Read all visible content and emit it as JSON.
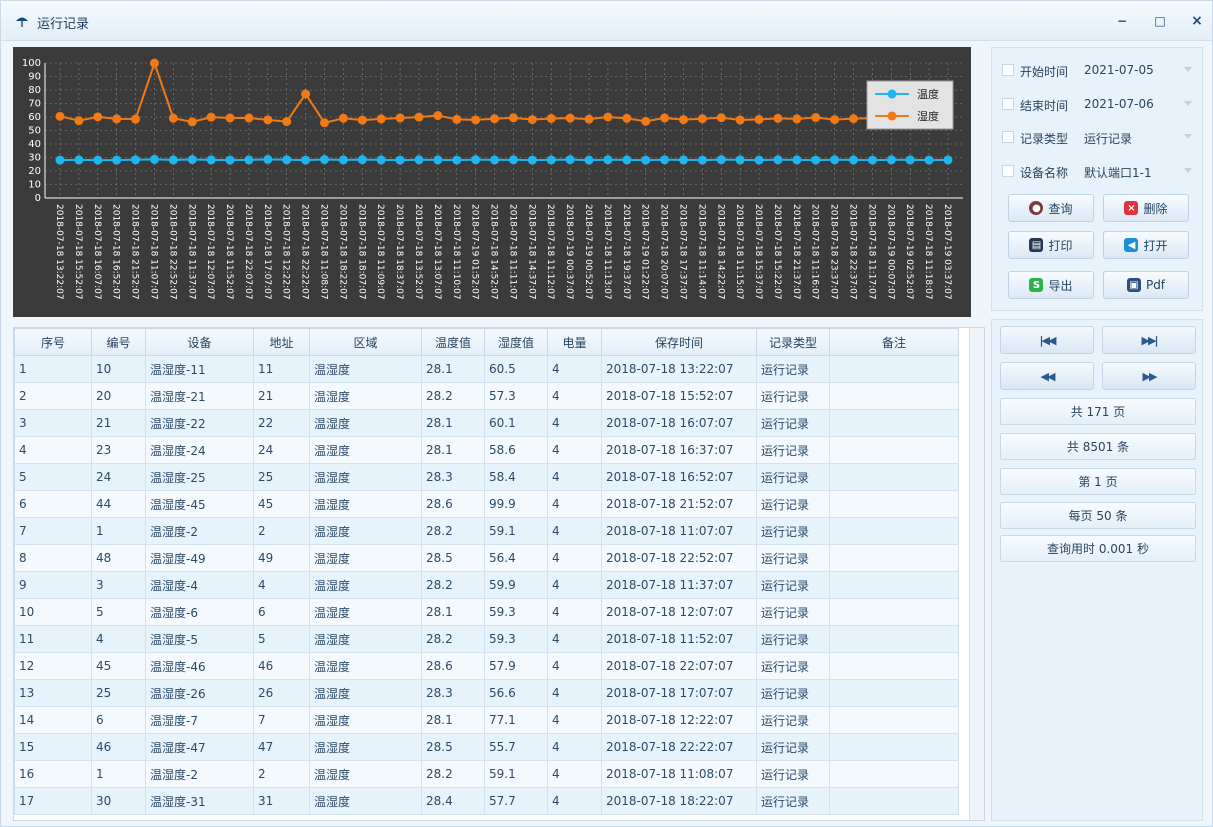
{
  "window": {
    "title": "运行记录",
    "controls": {
      "minimize": "−",
      "maximize": "□",
      "close": "×"
    }
  },
  "chart_data": {
    "type": "line",
    "ylim": [
      0,
      100
    ],
    "yticks": [
      0,
      10,
      20,
      30,
      40,
      50,
      60,
      70,
      80,
      90,
      100
    ],
    "grid": true,
    "legend_position": "top-right",
    "background": "#3b3b3b",
    "categories": [
      "2018-07-18 13:22:07",
      "2018-07-18 15:52:07",
      "2018-07-18 16:07:07",
      "2018-07-18 16:52:07",
      "2018-07-18 21:52:07",
      "2018-07-18 11:07:07",
      "2018-07-18 22:52:07",
      "2018-07-18 11:37:07",
      "2018-07-18 12:07:07",
      "2018-07-18 11:52:07",
      "2018-07-18 22:07:07",
      "2018-07-18 17:07:07",
      "2018-07-18 12:22:07",
      "2018-07-18 22:22:07",
      "2018-07-18 11:08:07",
      "2018-07-18 18:22:07",
      "2018-07-18 18:07:07",
      "2018-07-18 11:09:07",
      "2018-07-18 18:37:07",
      "2018-07-18 13:52:07",
      "2018-07-18 13:07:07",
      "2018-07-18 11:10:07",
      "2018-07-19 01:52:07",
      "2018-07-18 14:52:07",
      "2018-07-18 11:11:07",
      "2018-07-18 14:37:07",
      "2018-07-18 11:12:07",
      "2018-07-19 00:37:07",
      "2018-07-19 00:52:07",
      "2018-07-18 11:13:07",
      "2018-07-18 19:37:07",
      "2018-07-19 01:22:07",
      "2018-07-18 20:07:07",
      "2018-07-18 17:37:07",
      "2018-07-18 11:14:07",
      "2018-07-18 14:22:07",
      "2018-07-18 11:15:07",
      "2018-07-18 15:37:07",
      "2018-07-18 15:22:07",
      "2018-07-18 21:37:07",
      "2018-07-18 11:16:07",
      "2018-07-18 23:37:07",
      "2018-07-18 22:37:07",
      "2018-07-18 11:17:07",
      "2018-07-19 00:07:07",
      "2018-07-19 02:52:07",
      "2018-07-18 11:18:07",
      "2018-07-19 03:37:07"
    ],
    "series": [
      {
        "name": "温度",
        "color": "#1fb6ef",
        "values": [
          28.1,
          28.2,
          28.1,
          28.1,
          28.3,
          28.6,
          28.2,
          28.5,
          28.2,
          28.1,
          28.2,
          28.6,
          28.3,
          28.1,
          28.5,
          28.2,
          28.4,
          28.2,
          28.1,
          28.3,
          28.2,
          28.1,
          28.4,
          28.2,
          28.3,
          28.1,
          28.2,
          28.4,
          28.1,
          28.3,
          28.2,
          28.1,
          28.3,
          28.2,
          28.1,
          28.4,
          28.2,
          28.1,
          28.3,
          28.2,
          28.1,
          28.3,
          28.2,
          28.1,
          28.3,
          28.2,
          28.1,
          28.2
        ]
      },
      {
        "name": "湿度",
        "color": "#f07a14",
        "values": [
          60.5,
          57.3,
          60.1,
          58.6,
          58.4,
          99.9,
          59.1,
          56.4,
          59.9,
          59.3,
          59.3,
          57.9,
          56.6,
          77.1,
          55.7,
          59.1,
          57.7,
          58.6,
          59.3,
          59.9,
          61.1,
          58.2,
          57.9,
          58.7,
          59.4,
          58.1,
          58.9,
          59.2,
          58.4,
          60.0,
          59.0,
          56.8,
          59.3,
          58.1,
          58.7,
          59.5,
          57.8,
          58.2,
          59.0,
          58.6,
          59.6,
          58.1,
          58.8,
          59.2,
          58.4,
          59.0,
          58.6,
          58.8
        ]
      }
    ]
  },
  "filters": [
    {
      "label": "开始时间",
      "value": "2021-07-05"
    },
    {
      "label": "结束时间",
      "value": "2021-07-06"
    },
    {
      "label": "记录类型",
      "value": "运行记录"
    },
    {
      "label": "设备名称",
      "value": "默认端口1-1"
    }
  ],
  "actions": {
    "query": {
      "label": "查询",
      "icon": "query-icon",
      "color": "#7a3b3b"
    },
    "delete": {
      "label": "删除",
      "icon": "delete-icon",
      "color": "#e0323c"
    },
    "print": {
      "label": "打印",
      "icon": "print-icon",
      "color": "#243a54"
    },
    "open": {
      "label": "打开",
      "icon": "open-icon",
      "color": "#1d8fd8"
    },
    "export": {
      "label": "导出",
      "icon": "export-icon",
      "color": "#2fb24a"
    },
    "pdf": {
      "label": "Pdf",
      "icon": "pdf-icon",
      "color": "#2a4f80"
    }
  },
  "table": {
    "columns": [
      "序号",
      "编号",
      "设备",
      "地址",
      "区域",
      "温度值",
      "湿度值",
      "电量",
      "保存时间",
      "记录类型",
      "备注"
    ],
    "rows": [
      [
        "1",
        "10",
        "温湿度-11",
        "11",
        "温湿度",
        "28.1",
        "60.5",
        "4",
        "2018-07-18 13:22:07",
        "运行记录",
        ""
      ],
      [
        "2",
        "20",
        "温湿度-21",
        "21",
        "温湿度",
        "28.2",
        "57.3",
        "4",
        "2018-07-18 15:52:07",
        "运行记录",
        ""
      ],
      [
        "3",
        "21",
        "温湿度-22",
        "22",
        "温湿度",
        "28.1",
        "60.1",
        "4",
        "2018-07-18 16:07:07",
        "运行记录",
        ""
      ],
      [
        "4",
        "23",
        "温湿度-24",
        "24",
        "温湿度",
        "28.1",
        "58.6",
        "4",
        "2018-07-18 16:37:07",
        "运行记录",
        ""
      ],
      [
        "5",
        "24",
        "温湿度-25",
        "25",
        "温湿度",
        "28.3",
        "58.4",
        "4",
        "2018-07-18 16:52:07",
        "运行记录",
        ""
      ],
      [
        "6",
        "44",
        "温湿度-45",
        "45",
        "温湿度",
        "28.6",
        "99.9",
        "4",
        "2018-07-18 21:52:07",
        "运行记录",
        ""
      ],
      [
        "7",
        "1",
        "温湿度-2",
        "2",
        "温湿度",
        "28.2",
        "59.1",
        "4",
        "2018-07-18 11:07:07",
        "运行记录",
        ""
      ],
      [
        "8",
        "48",
        "温湿度-49",
        "49",
        "温湿度",
        "28.5",
        "56.4",
        "4",
        "2018-07-18 22:52:07",
        "运行记录",
        ""
      ],
      [
        "9",
        "3",
        "温湿度-4",
        "4",
        "温湿度",
        "28.2",
        "59.9",
        "4",
        "2018-07-18 11:37:07",
        "运行记录",
        ""
      ],
      [
        "10",
        "5",
        "温湿度-6",
        "6",
        "温湿度",
        "28.1",
        "59.3",
        "4",
        "2018-07-18 12:07:07",
        "运行记录",
        ""
      ],
      [
        "11",
        "4",
        "温湿度-5",
        "5",
        "温湿度",
        "28.2",
        "59.3",
        "4",
        "2018-07-18 11:52:07",
        "运行记录",
        ""
      ],
      [
        "12",
        "45",
        "温湿度-46",
        "46",
        "温湿度",
        "28.6",
        "57.9",
        "4",
        "2018-07-18 22:07:07",
        "运行记录",
        ""
      ],
      [
        "13",
        "25",
        "温湿度-26",
        "26",
        "温湿度",
        "28.3",
        "56.6",
        "4",
        "2018-07-18 17:07:07",
        "运行记录",
        ""
      ],
      [
        "14",
        "6",
        "温湿度-7",
        "7",
        "温湿度",
        "28.1",
        "77.1",
        "4",
        "2018-07-18 12:22:07",
        "运行记录",
        ""
      ],
      [
        "15",
        "46",
        "温湿度-47",
        "47",
        "温湿度",
        "28.5",
        "55.7",
        "4",
        "2018-07-18 22:22:07",
        "运行记录",
        ""
      ],
      [
        "16",
        "1",
        "温湿度-2",
        "2",
        "温湿度",
        "28.2",
        "59.1",
        "4",
        "2018-07-18 11:08:07",
        "运行记录",
        ""
      ],
      [
        "17",
        "30",
        "温湿度-31",
        "31",
        "温湿度",
        "28.4",
        "57.7",
        "4",
        "2018-07-18 18:22:07",
        "运行记录",
        ""
      ]
    ]
  },
  "pagination": {
    "first_icon": "first-page-icon",
    "last_icon": "last-page-icon",
    "prev_icon": "prev-page-icon",
    "next_icon": "next-page-icon",
    "total_pages": "共 171 页",
    "total_records": "共 8501 条",
    "current_page": "第 1 页",
    "page_size": "每页 50 条",
    "query_time": "查询用时 0.001 秒"
  }
}
